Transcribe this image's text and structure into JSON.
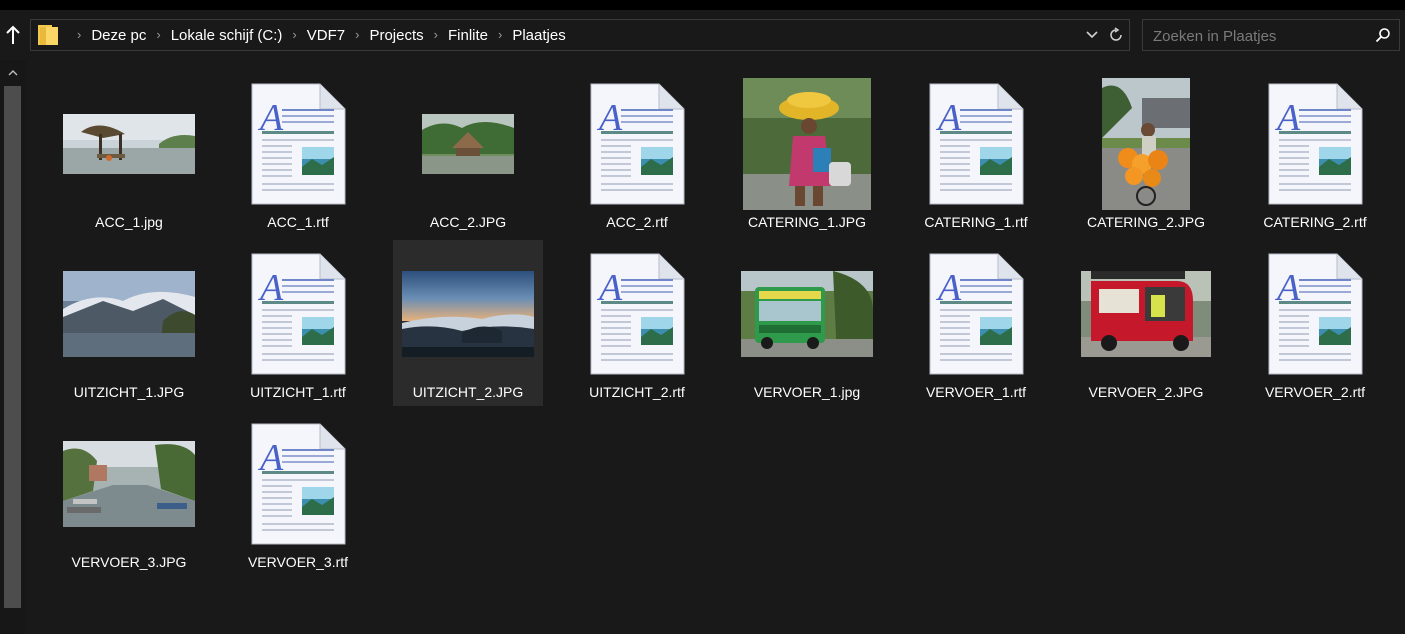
{
  "address": {
    "breadcrumb": [
      "Deze pc",
      "Lokale schijf (C:)",
      "VDF7",
      "Projects",
      "Finlite",
      "Plaatjes"
    ],
    "separator": "›"
  },
  "search": {
    "placeholder": "Zoeken in Plaatjes"
  },
  "icons": {
    "up": "arrow-up-icon",
    "folder": "folder-icon",
    "dropdown": "chevron-down-icon",
    "refresh": "refresh-icon",
    "search": "search-icon",
    "scroll_up": "scroll-up-arrow-icon"
  },
  "colors": {
    "background": "#191919",
    "selected_tile": "#2b2b2b",
    "scroll_thumb": "#4d4d4d"
  },
  "files": [
    {
      "name": "ACC_1.jpg",
      "type": "image",
      "preview": "pier"
    },
    {
      "name": "ACC_1.rtf",
      "type": "rtf"
    },
    {
      "name": "ACC_2.JPG",
      "type": "image",
      "preview": "hut"
    },
    {
      "name": "ACC_2.rtf",
      "type": "rtf"
    },
    {
      "name": "CATERING_1.JPG",
      "type": "image",
      "preview": "woman"
    },
    {
      "name": "CATERING_1.rtf",
      "type": "rtf"
    },
    {
      "name": "CATERING_2.JPG",
      "type": "image",
      "preview": "bicycle"
    },
    {
      "name": "CATERING_2.rtf",
      "type": "rtf"
    },
    {
      "name": "UITZICHT_1.JPG",
      "type": "image",
      "preview": "mountains"
    },
    {
      "name": "UITZICHT_1.rtf",
      "type": "rtf"
    },
    {
      "name": "UITZICHT_2.JPG",
      "type": "image",
      "preview": "sunrise",
      "selected": true
    },
    {
      "name": "UITZICHT_2.rtf",
      "type": "rtf"
    },
    {
      "name": "VERVOER_1.jpg",
      "type": "image",
      "preview": "bus"
    },
    {
      "name": "VERVOER_1.rtf",
      "type": "rtf"
    },
    {
      "name": "VERVOER_2.JPG",
      "type": "image",
      "preview": "tuktuk"
    },
    {
      "name": "VERVOER_2.rtf",
      "type": "rtf"
    },
    {
      "name": "VERVOER_3.JPG",
      "type": "image",
      "preview": "canal"
    },
    {
      "name": "VERVOER_3.rtf",
      "type": "rtf"
    }
  ]
}
